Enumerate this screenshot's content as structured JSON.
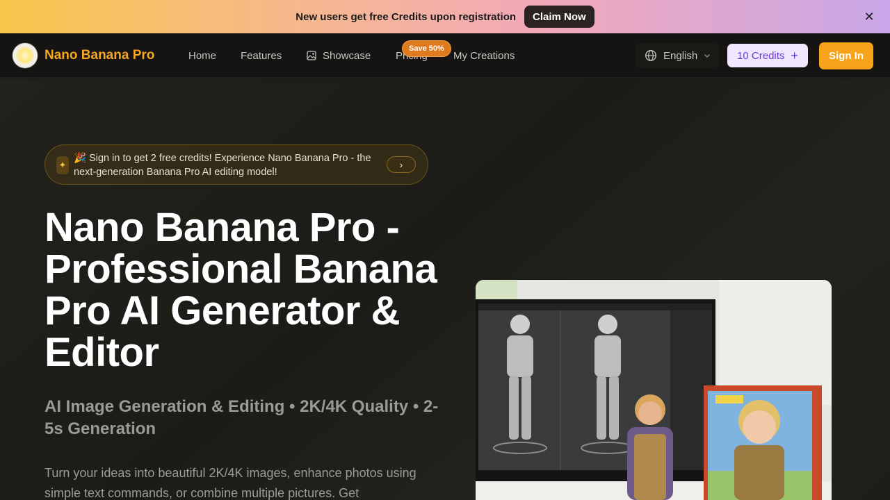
{
  "promo": {
    "text": "New users get free Credits upon registration",
    "button": "Claim Now",
    "close": "✕"
  },
  "nav": {
    "brand": "Nano Banana Pro",
    "links": {
      "home": "Home",
      "features": "Features",
      "showcase": "Showcase",
      "pricing": "Pricing",
      "creations": "My Creations"
    },
    "save_badge": "Save 50%",
    "language": "English",
    "credits": "10 Credits",
    "signin": "Sign In"
  },
  "hero": {
    "announcement": "🎉 Sign in to get 2 free credits! Experience Nano Banana Pro - the next-generation Banana Pro AI editing model!",
    "title": "Nano Banana Pro - Professional Banana Pro AI Generator & Editor",
    "subtitle": "AI Image Generation & Editing • 2K/4K Quality • 2-5s Generation",
    "description": "Turn your ideas into beautiful 2K/4K images, enhance photos using simple text commands, or combine multiple pictures. Get"
  },
  "colors": {
    "accent": "#f6a21a",
    "brand_text": "#f5a623",
    "credits_bg": "#efe6ff",
    "credits_text": "#6a3bd1",
    "badge": "#e07a1f"
  }
}
